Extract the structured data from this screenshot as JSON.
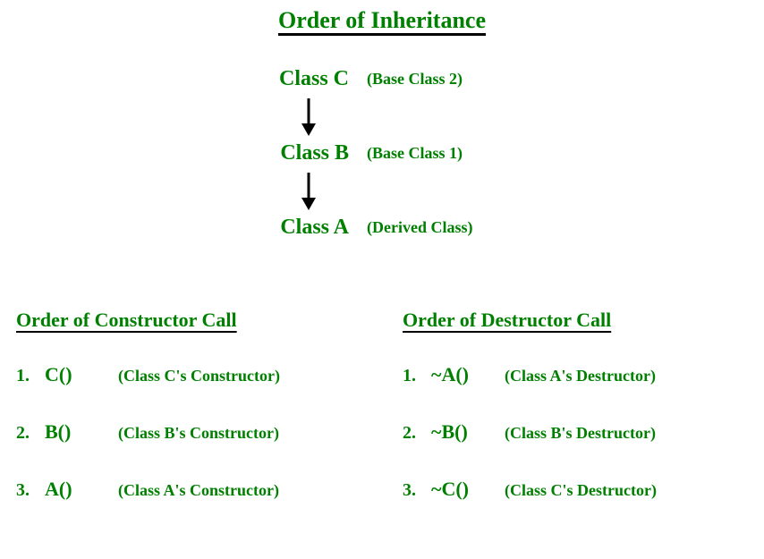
{
  "title": "Order of Inheritance",
  "hierarchy": [
    {
      "name": "Class C",
      "desc": "(Base Class 2)"
    },
    {
      "name": "Class B",
      "desc": "(Base Class 1)"
    },
    {
      "name": "Class A",
      "desc": "(Derived Class)"
    }
  ],
  "constructor_section": {
    "title": "Order of Constructor Call",
    "items": [
      {
        "num": "1.",
        "name": "C()",
        "desc": "(Class C's Constructor)"
      },
      {
        "num": "2.",
        "name": "B()",
        "desc": "(Class B's Constructor)"
      },
      {
        "num": "3.",
        "name": "A()",
        "desc": "(Class A's Constructor)"
      }
    ]
  },
  "destructor_section": {
    "title": "Order of Destructor Call",
    "items": [
      {
        "num": "1.",
        "name": "~A()",
        "desc": "(Class A's Destructor)"
      },
      {
        "num": "2.",
        "name": "~B()",
        "desc": "(Class B's Destructor)"
      },
      {
        "num": "3.",
        "name": "~C()",
        "desc": "(Class C's Destructor)"
      }
    ]
  }
}
